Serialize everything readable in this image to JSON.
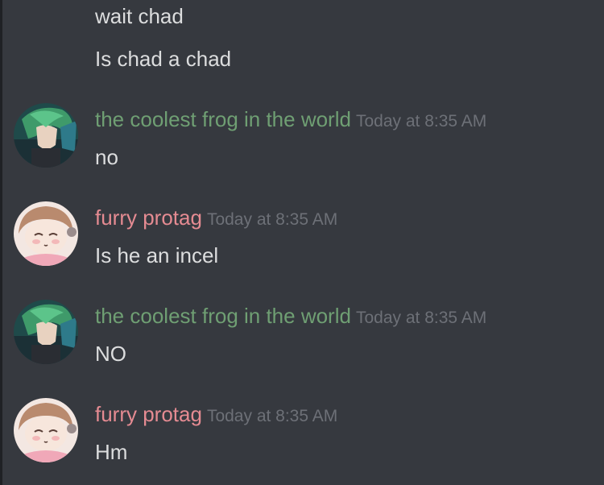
{
  "colors": {
    "background": "#36393f",
    "message_text": "#dcddde",
    "timestamp": "#6d7077",
    "author_green": "#6f9f73",
    "author_pink": "#e58b92"
  },
  "messages": [
    {
      "text": "wait chad"
    },
    {
      "text": "Is chad a chad"
    },
    {
      "author": "the coolest frog in the world",
      "timestamp": "Today at 8:35 AM",
      "avatar": "green-haired-character-avatar",
      "text": "no"
    },
    {
      "author": "furry protag",
      "timestamp": "Today at 8:35 AM",
      "avatar": "sleepy-anime-character-avatar",
      "text": "Is he an incel"
    },
    {
      "author": "the coolest frog in the world",
      "timestamp": "Today at 8:35 AM",
      "avatar": "green-haired-character-avatar",
      "text": "NO"
    },
    {
      "author": "furry protag",
      "timestamp": "Today at 8:35 AM",
      "avatar": "sleepy-anime-character-avatar",
      "text": "Hm"
    }
  ]
}
